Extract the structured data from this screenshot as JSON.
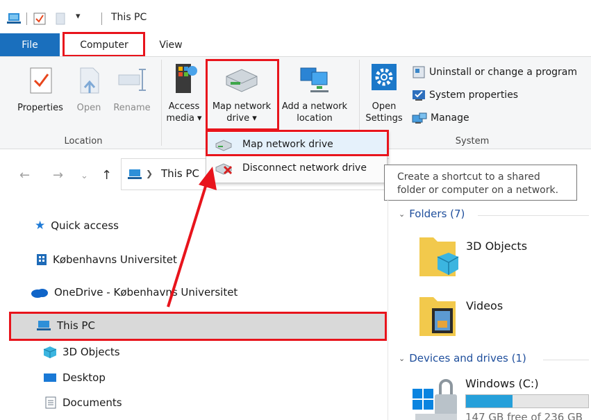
{
  "window": {
    "title": "This PC"
  },
  "ribbon_tabs": {
    "file": "File",
    "computer": "Computer",
    "view": "View"
  },
  "ribbon": {
    "location": {
      "label": "Location",
      "properties": "Properties",
      "open": "Open",
      "rename": "Rename"
    },
    "network": {
      "access_media_l1": "Access",
      "access_media_l2": "media ▾",
      "map_drive_l1": "Map network",
      "map_drive_l2": "drive ▾",
      "add_location_l1": "Add a network",
      "add_location_l2": "location"
    },
    "system": {
      "label": "System",
      "open_settings_l1": "Open",
      "open_settings_l2": "Settings",
      "uninstall": "Uninstall or change a program",
      "system_properties": "System properties",
      "manage": "Manage"
    }
  },
  "dropdown": {
    "map_network_drive": "Map network drive",
    "disconnect_network_drive": "Disconnect network drive"
  },
  "tooltip": {
    "line1": "Create a shortcut to a shared",
    "line2": "folder or computer on a network."
  },
  "address": {
    "location": "This PC"
  },
  "nav_pane": {
    "quick_access": "Quick access",
    "kobenhavns": "Københavns Universitet",
    "onedrive": "OneDrive - Københavns Universitet",
    "this_pc": "This PC",
    "objects_3d": "3D Objects",
    "desktop": "Desktop",
    "documents": "Documents"
  },
  "content": {
    "folders_header": "Folders (7)",
    "folders": [
      "3D Objects",
      "Videos"
    ],
    "devices_header": "Devices and drives (1)",
    "drive_name": "Windows (C:)",
    "drive_free": "147 GB free of 236 GB",
    "drive_used_fraction": 0.38
  },
  "colors": {
    "accent": "#1a6fbd",
    "highlight_box": "#e8141c",
    "drive_bar": "#26a0da",
    "section_header": "#1e4e9c"
  }
}
